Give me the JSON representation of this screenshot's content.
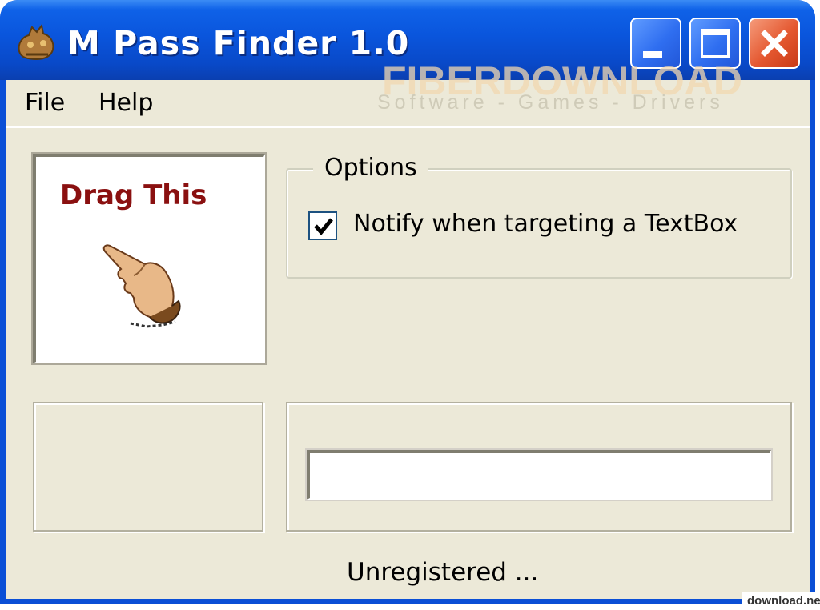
{
  "window": {
    "title": "M Pass Finder 1.0",
    "titlebar_color": "#0a55dc",
    "controls": [
      "minimize-icon",
      "maximize-icon",
      "close-icon"
    ]
  },
  "menu": {
    "items": [
      "File",
      "Help"
    ]
  },
  "watermark": {
    "brand": "FIBERDOWNLOAD",
    "tagline": "Software - Games - Drivers"
  },
  "drag_box": {
    "label": "Drag This",
    "label_color": "#8a1010",
    "icon": "pointing-hand-icon"
  },
  "options": {
    "legend": "Options",
    "notify_checkbox": {
      "label": "Notify when targeting a TextBox",
      "checked": true
    }
  },
  "result_field": {
    "value": ""
  },
  "status": {
    "text": "Unregistered ..."
  },
  "badge": {
    "text": "download.net.pl"
  }
}
